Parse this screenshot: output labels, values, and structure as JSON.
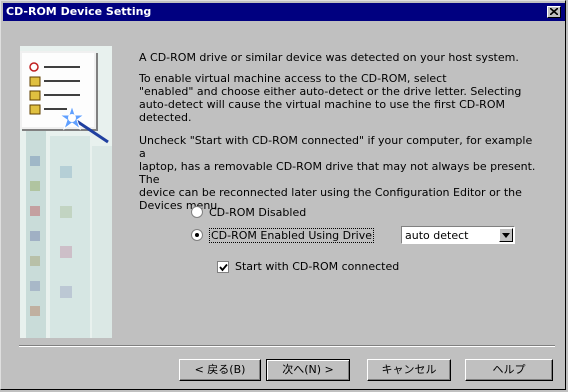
{
  "window": {
    "title": "CD-ROM Device Setting"
  },
  "content": {
    "paragraph1": "A CD-ROM drive or similar device was detected on your host system.",
    "paragraph2": "To enable virtual machine access to the CD-ROM, select\n\"enabled\" and choose either auto-detect or the drive letter. Selecting\nauto-detect will cause the virtual machine to use the first CD-ROM\ndetected.",
    "paragraph3": "Uncheck \"Start with CD-ROM connected\" if your computer, for example a\nlaptop, has a removable CD-ROM drive that may not always be present. The\ndevice can be reconnected later using the Configuration Editor or the\nDevices menu."
  },
  "options": {
    "disabled_label": "CD-ROM Disabled",
    "enabled_label": "CD-ROM Enabled Using Drive",
    "selected": "enabled",
    "drive_value": "auto detect",
    "start_connected_label": "Start with CD-ROM connected",
    "start_connected_checked": true
  },
  "buttons": {
    "back": "< 戻る(B)",
    "next": "次へ(N) >",
    "cancel": "キャンセル",
    "help": "ヘルプ"
  }
}
